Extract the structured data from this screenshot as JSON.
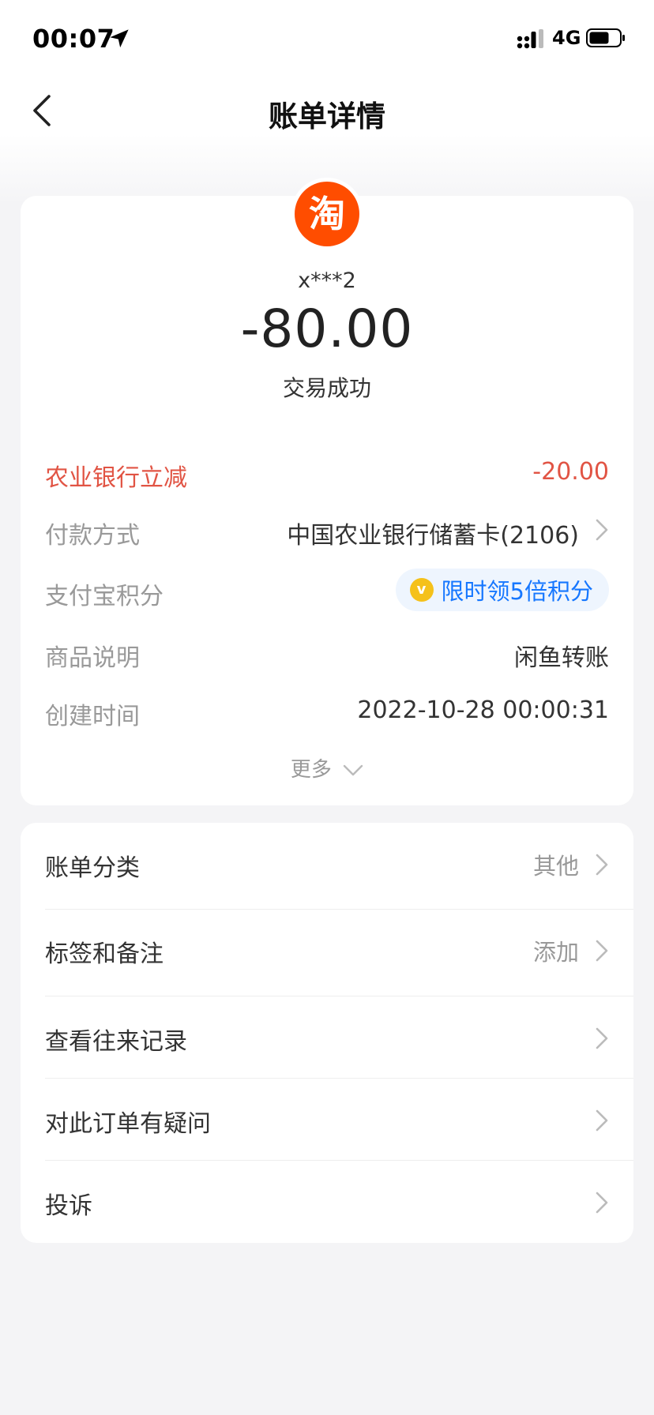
{
  "status_bar": {
    "time": "00:07",
    "network": "4G",
    "icons": [
      "location-arrow-icon",
      "signal-icon",
      "battery-icon"
    ]
  },
  "nav": {
    "title": "账单详情",
    "back_icon": "chevron-left-icon"
  },
  "summary": {
    "merchant_logo_char": "淘",
    "counterparty": "x***2",
    "amount": "-80.00",
    "status": "交易成功",
    "logo_color": "#ff4d00"
  },
  "details": {
    "discount_label": "农业银行立减",
    "discount_value": "-20.00",
    "payment_label": "付款方式",
    "payment_value": "中国农业银行储蓄卡(2106)",
    "points_label": "支付宝积分",
    "points_coin_char": "v",
    "points_promo": "限时领5倍积分",
    "desc_label": "商品说明",
    "desc_value": "闲鱼转账",
    "time_label": "创建时间",
    "time_value": "2022-10-28 00:00:31",
    "more_label": "更多"
  },
  "actions": [
    {
      "label": "账单分类",
      "value": "其他"
    },
    {
      "label": "标签和备注",
      "value": "添加"
    },
    {
      "label": "查看往来记录",
      "value": ""
    },
    {
      "label": "对此订单有疑问",
      "value": ""
    },
    {
      "label": "投诉",
      "value": ""
    }
  ],
  "colors": {
    "accent_red": "#e15444",
    "link_blue": "#1677ff",
    "background": "#f4f4f6"
  }
}
